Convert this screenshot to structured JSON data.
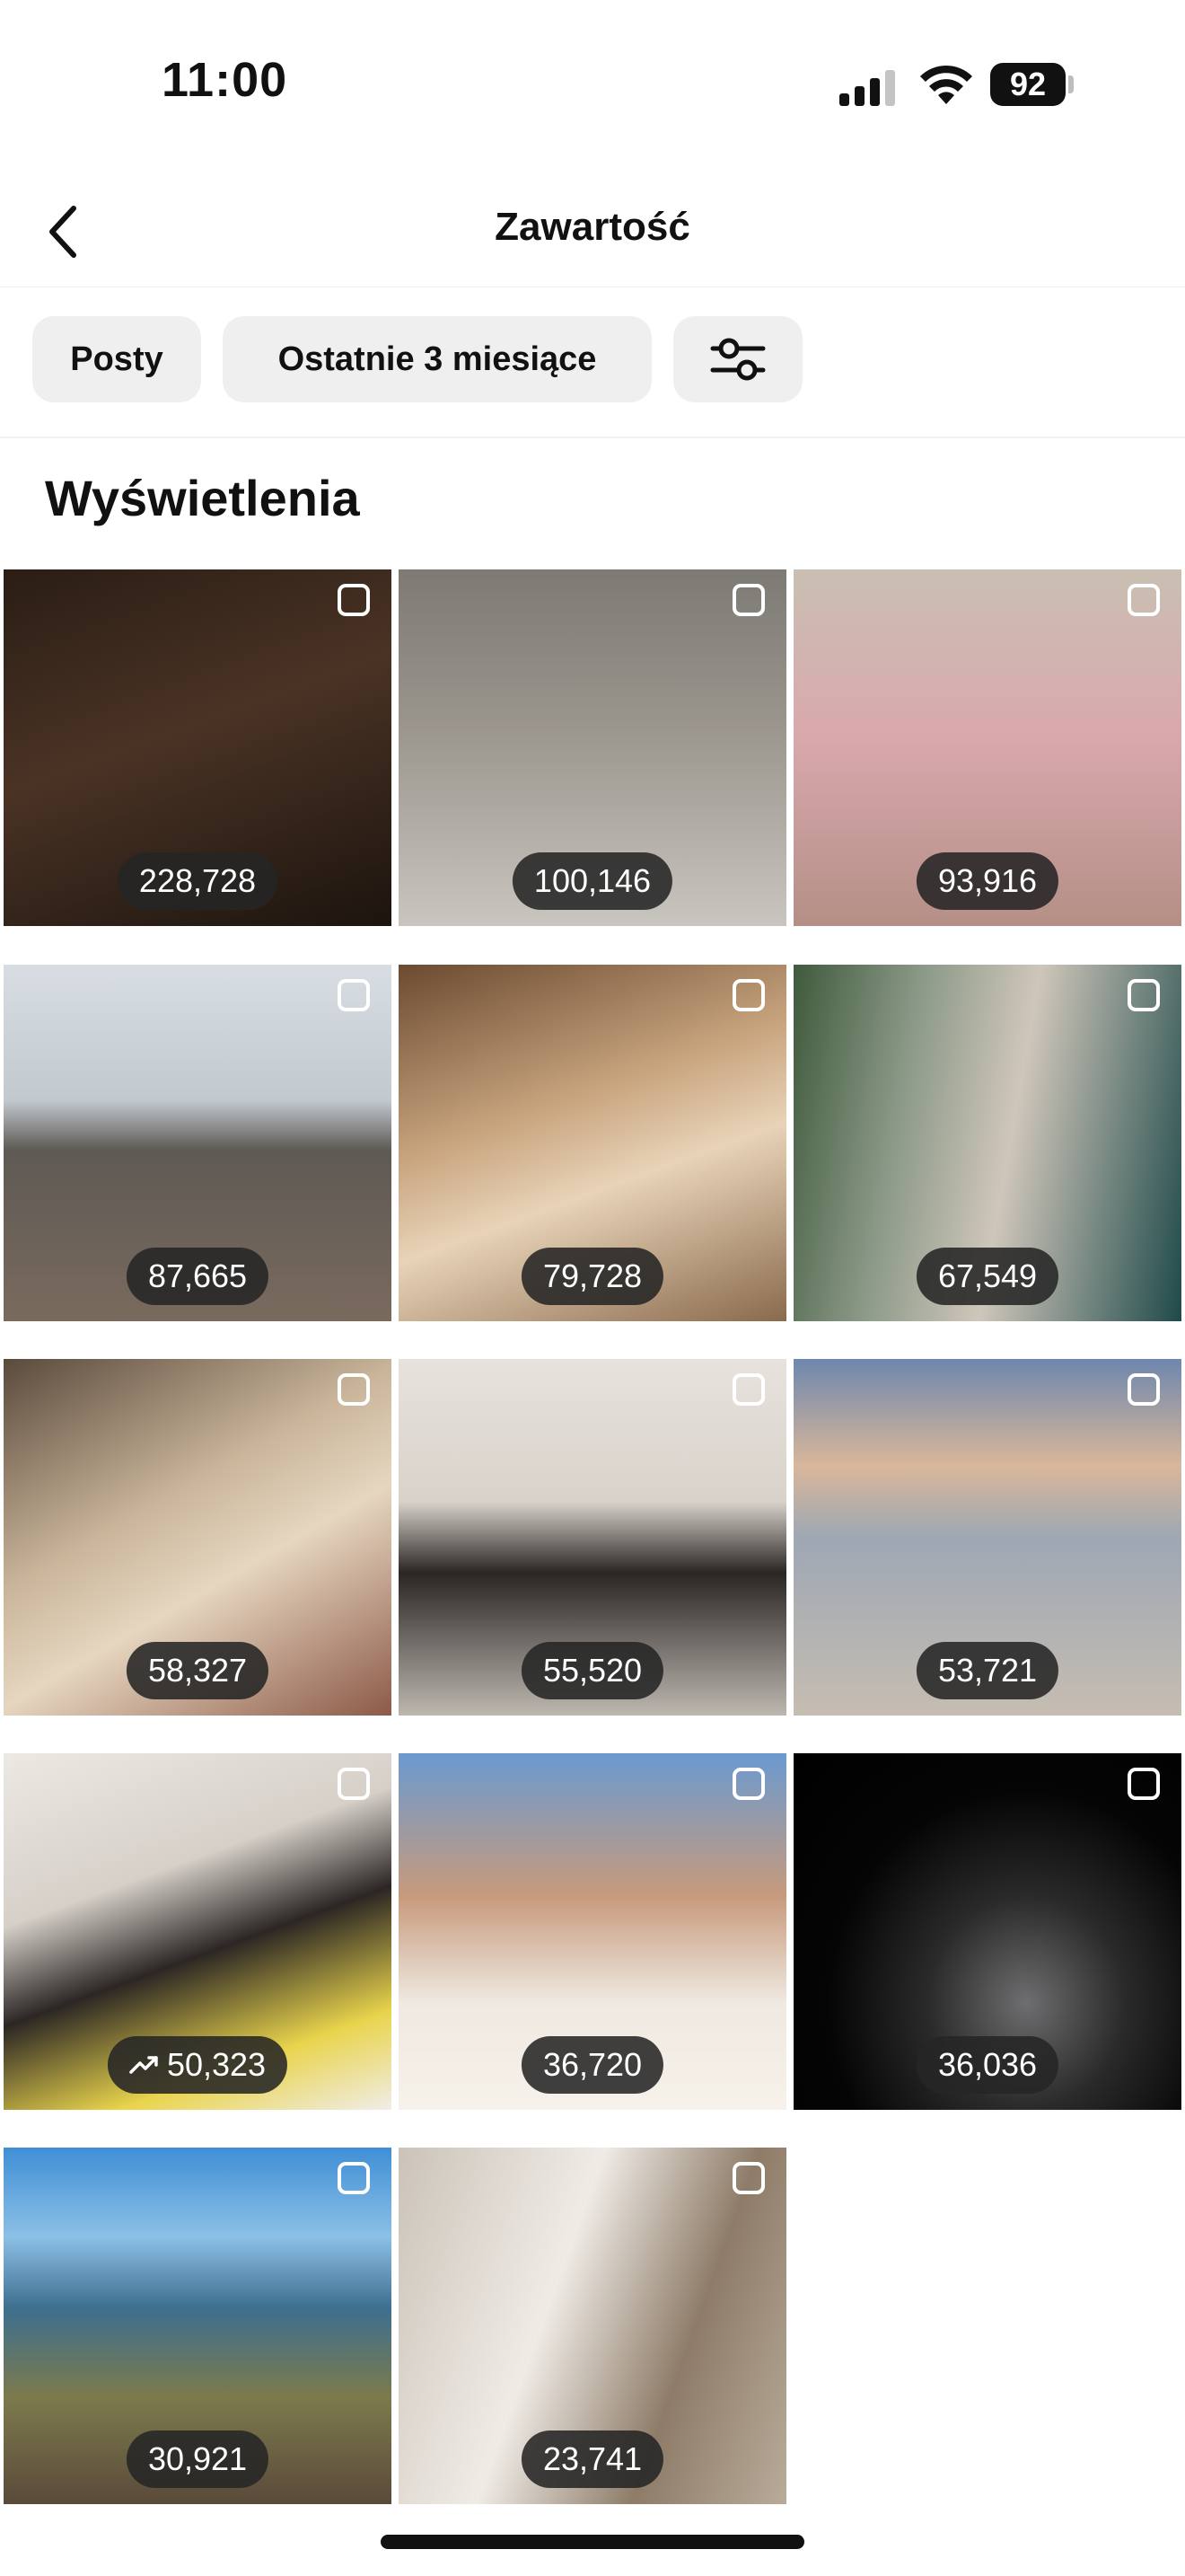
{
  "status_bar": {
    "time": "11:00",
    "battery": "92"
  },
  "nav": {
    "title": "Zawartość"
  },
  "filters": {
    "posts_label": "Posty",
    "range_label": "Ostatnie 3 miesiące"
  },
  "section": {
    "title": "Wyświetlenia"
  },
  "tiles": [
    {
      "views": "228,728"
    },
    {
      "views": "100,146"
    },
    {
      "views": "93,916"
    },
    {
      "views": "87,665"
    },
    {
      "views": "79,728"
    },
    {
      "views": "67,549"
    },
    {
      "views": "58,327"
    },
    {
      "views": "55,520"
    },
    {
      "views": "53,721"
    },
    {
      "views": "50,323",
      "trending": true
    },
    {
      "views": "36,720"
    },
    {
      "views": "36,036"
    },
    {
      "views": "30,921"
    },
    {
      "views": "23,741"
    }
  ]
}
